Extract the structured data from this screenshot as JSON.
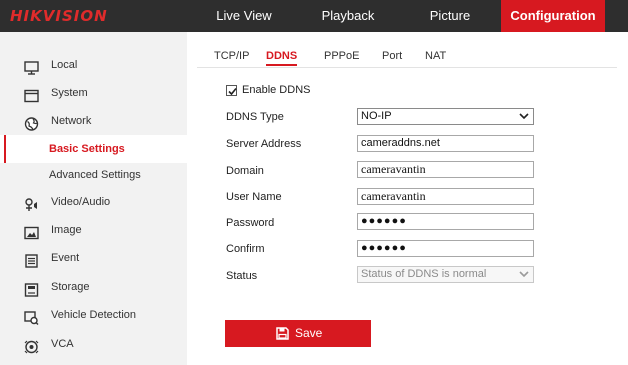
{
  "brand": {
    "logo_text": "HIKVISION",
    "accent": "#d71920",
    "logo_color": "#e02b2b",
    "topbar_bg": "#2e2e2e"
  },
  "topnav": {
    "items": [
      {
        "label": "Live View"
      },
      {
        "label": "Playback"
      },
      {
        "label": "Picture"
      },
      {
        "label": "Configuration",
        "active": true
      }
    ]
  },
  "sidebar": {
    "items": [
      {
        "label": "Local",
        "icon": "monitor-icon"
      },
      {
        "label": "System",
        "icon": "system-window-icon"
      },
      {
        "label": "Network",
        "icon": "globe-icon"
      },
      {
        "label": "Basic Settings",
        "active": true
      },
      {
        "label": "Advanced Settings"
      },
      {
        "label": "Video/Audio",
        "icon": "video-audio-icon"
      },
      {
        "label": "Image",
        "icon": "image-icon"
      },
      {
        "label": "Event",
        "icon": "event-list-icon"
      },
      {
        "label": "Storage",
        "icon": "storage-icon"
      },
      {
        "label": "Vehicle Detection",
        "icon": "vehicle-detection-icon"
      },
      {
        "label": "VCA",
        "icon": "vca-icon"
      }
    ]
  },
  "tabs": [
    {
      "label": "TCP/IP"
    },
    {
      "label": "DDNS",
      "active": true
    },
    {
      "label": "PPPoE"
    },
    {
      "label": "Port"
    },
    {
      "label": "NAT"
    }
  ],
  "form": {
    "enable_ddns": {
      "label": "Enable DDNS",
      "checked": true
    },
    "ddns_type": {
      "label": "DDNS Type",
      "value": "NO-IP"
    },
    "server_address": {
      "label": "Server Address",
      "value": "cameraddns.net"
    },
    "domain": {
      "label": "Domain",
      "value": "cameravantin"
    },
    "user_name": {
      "label": "User Name",
      "value": "cameravantin"
    },
    "password": {
      "label": "Password",
      "value": "●●●●●●"
    },
    "confirm": {
      "label": "Confirm",
      "value": "●●●●●●"
    },
    "status": {
      "label": "Status",
      "value": "Status of DDNS is normal"
    }
  },
  "save_button": {
    "label": "Save",
    "icon": "floppy-disk-icon"
  }
}
